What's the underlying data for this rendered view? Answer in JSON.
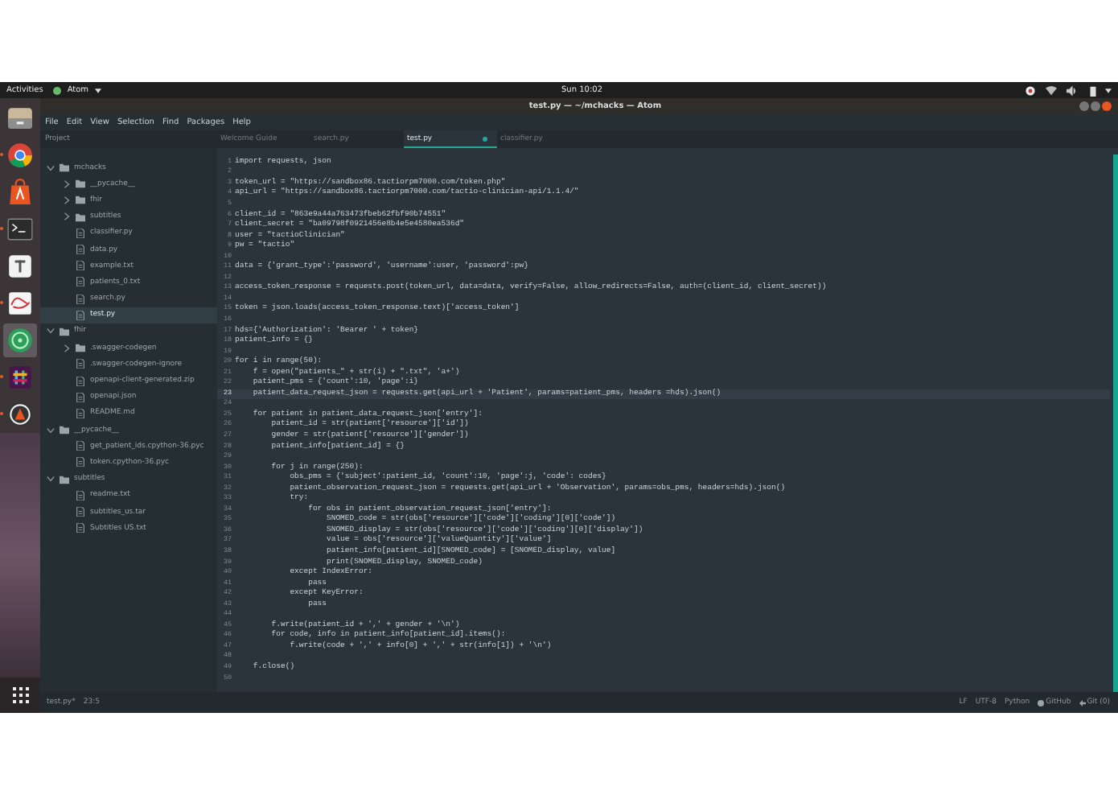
{
  "top_bar": {
    "activities": "Activities",
    "app_name": "Atom",
    "clock": "Sun 10:02"
  },
  "dock": {
    "items": [
      {
        "kind": "files",
        "running": false,
        "selected": false
      },
      {
        "kind": "browser",
        "running": true,
        "selected": false
      },
      {
        "kind": "store",
        "running": false,
        "selected": false
      },
      {
        "kind": "terminal",
        "running": true,
        "selected": false
      },
      {
        "kind": "notes",
        "running": false,
        "selected": false
      },
      {
        "kind": "scribble",
        "running": true,
        "selected": false
      },
      {
        "kind": "editor",
        "running": false,
        "selected": true
      },
      {
        "kind": "chat",
        "running": true,
        "selected": false
      },
      {
        "kind": "vpn",
        "running": true,
        "selected": false
      }
    ]
  },
  "window": {
    "title": "test.py — ~/mchacks — Atom"
  },
  "menu_bar": [
    "File",
    "Edit",
    "View",
    "Selection",
    "Find",
    "Packages",
    "Help"
  ],
  "sidebar": {
    "header": "Project",
    "tree": [
      {
        "name": "mchacks",
        "kind": "folder",
        "expanded": true,
        "selected": false,
        "children": [
          {
            "name": "__pycache__",
            "kind": "folder",
            "expanded": false,
            "selected": false
          },
          {
            "name": "fhir",
            "kind": "folder",
            "expanded": false,
            "selected": false
          },
          {
            "name": "subtitles",
            "kind": "folder",
            "expanded": false,
            "selected": false
          },
          {
            "name": "classifier.py",
            "kind": "file",
            "selected": false
          },
          {
            "name": "data.py",
            "kind": "file",
            "selected": false
          },
          {
            "name": "example.txt",
            "kind": "file",
            "selected": false
          },
          {
            "name": "patients_0.txt",
            "kind": "file",
            "selected": false
          },
          {
            "name": "search.py",
            "kind": "file",
            "selected": false
          },
          {
            "name": "test.py",
            "kind": "file",
            "selected": true
          }
        ]
      },
      {
        "name": "fhir",
        "kind": "folder",
        "expanded": true,
        "selected": false,
        "children": [
          {
            "name": ".swagger-codegen",
            "kind": "folder",
            "expanded": false,
            "selected": false
          },
          {
            "name": ".swagger-codegen-ignore",
            "kind": "file",
            "selected": false
          },
          {
            "name": "openapi-client-generated.zip",
            "kind": "file",
            "selected": false
          },
          {
            "name": "openapi.json",
            "kind": "file",
            "selected": false
          },
          {
            "name": "README.md",
            "kind": "file",
            "selected": false
          }
        ]
      },
      {
        "name": "__pycache__",
        "kind": "folder",
        "expanded": true,
        "selected": false,
        "children": [
          {
            "name": "get_patient_ids.cpython-36.pyc",
            "kind": "file",
            "selected": false
          },
          {
            "name": "token.cpython-36.pyc",
            "kind": "file",
            "selected": false
          }
        ]
      },
      {
        "name": "subtitles",
        "kind": "folder",
        "expanded": true,
        "selected": false,
        "children": [
          {
            "name": "readme.txt",
            "kind": "file",
            "selected": false
          },
          {
            "name": "subtitles_us.tar",
            "kind": "file",
            "selected": false
          },
          {
            "name": "Subtitles US.txt",
            "kind": "file",
            "selected": false
          }
        ]
      }
    ]
  },
  "tabs": [
    {
      "label": "Welcome Guide",
      "selected": false,
      "modified": false
    },
    {
      "label": "search.py",
      "selected": false,
      "modified": false
    },
    {
      "label": "test.py",
      "selected": true,
      "modified": true
    },
    {
      "label": "classifier.py",
      "selected": false,
      "modified": false
    }
  ],
  "editor": {
    "lines": [
      {
        "number": "1",
        "text": "import requests, json",
        "current": false
      },
      {
        "number": "2",
        "current": false
      },
      {
        "number": "3",
        "text": "token_url = \"https://sandbox86.tactiorpm7000.com/token.php\"",
        "current": false
      },
      {
        "number": "4",
        "text": "api_url = \"https://sandbox86.tactiorpm7000.com/tactio-clinician-api/1.1.4/\"",
        "current": false
      },
      {
        "number": "5",
        "current": false
      },
      {
        "number": "6",
        "text": "client_id = \"863e9a44a763473fbeb62fbf90b74551\"",
        "current": false
      },
      {
        "number": "7",
        "text": "client_secret = \"ba09798f0921456e8b4e5e4580ea536d\"",
        "current": false
      },
      {
        "number": "8",
        "text": "user = \"tactioClinician\"",
        "current": false
      },
      {
        "number": "9",
        "text": "pw = \"tactio\"",
        "current": false
      },
      {
        "number": "10",
        "current": false
      },
      {
        "number": "11",
        "text": "data = {'grant_type':'password', 'username':user, 'password':pw}",
        "current": false
      },
      {
        "number": "12",
        "current": false
      },
      {
        "number": "13",
        "text": "access_token_response = requests.post(token_url, data=data, verify=False, allow_redirects=False, auth=(client_id, client_secret))",
        "current": false
      },
      {
        "number": "14",
        "current": false
      },
      {
        "number": "15",
        "text": "token = json.loads(access_token_response.text)['access_token']",
        "current": false
      },
      {
        "number": "16",
        "current": false
      },
      {
        "number": "17",
        "text": "hds={'Authorization': 'Bearer ' + token}",
        "current": false
      },
      {
        "number": "18",
        "text": "patient_info = {}",
        "current": false
      },
      {
        "number": "19",
        "current": false
      },
      {
        "number": "20",
        "text": "for i in range(50):",
        "current": false
      },
      {
        "number": "21",
        "text": "    f = open(\"patients_\" + str(i) + \".txt\", 'a+')",
        "current": false
      },
      {
        "number": "22",
        "text": "    patient_pms = {'count':10, 'page':i}",
        "current": false
      },
      {
        "number": "23",
        "text": "    patient_data_request_json = requests.get(api_url + 'Patient', params=patient_pms, headers =hds).json()",
        "current": true
      },
      {
        "number": "24",
        "current": false
      },
      {
        "number": "25",
        "text": "    for patient in patient_data_request_json['entry']:",
        "current": false
      },
      {
        "number": "26",
        "text": "        patient_id = str(patient['resource']['id'])",
        "current": false
      },
      {
        "number": "27",
        "text": "        gender = str(patient['resource']['gender'])",
        "current": false
      },
      {
        "number": "28",
        "text": "        patient_info[patient_id] = {}",
        "current": false
      },
      {
        "number": "29",
        "current": false
      },
      {
        "number": "30",
        "text": "        for j in range(250):",
        "current": false
      },
      {
        "number": "31",
        "text": "            obs_pms = {'subject':patient_id, 'count':10, 'page':j, 'code': codes}",
        "current": false
      },
      {
        "number": "32",
        "text": "            patient_observation_request_json = requests.get(api_url + 'Observation', params=obs_pms, headers=hds).json()",
        "current": false
      },
      {
        "number": "33",
        "text": "            try:",
        "current": false
      },
      {
        "number": "34",
        "text": "                for obs in patient_observation_request_json['entry']:",
        "current": false
      },
      {
        "number": "35",
        "text": "                    SNOMED_code = str(obs['resource']['code']['coding'][0]['code'])",
        "current": false
      },
      {
        "number": "36",
        "text": "                    SNOMED_display = str(obs['resource']['code']['coding'][0]['display'])",
        "current": false
      },
      {
        "number": "37",
        "text": "                    value = obs['resource']['valueQuantity']['value']",
        "current": false
      },
      {
        "number": "38",
        "text": "                    patient_info[patient_id][SNOMED_code] = [SNOMED_display, value]",
        "current": false
      },
      {
        "number": "39",
        "text": "                    print(SNOMED_display, SNOMED_code)",
        "current": false
      },
      {
        "number": "40",
        "text": "            except IndexError:",
        "current": false
      },
      {
        "number": "41",
        "text": "                pass",
        "current": false
      },
      {
        "number": "42",
        "text": "            except KeyError:",
        "current": false
      },
      {
        "number": "43",
        "text": "                pass",
        "current": false
      },
      {
        "number": "44",
        "current": false
      },
      {
        "number": "45",
        "text": "        f.write(patient_id + ',' + gender + '\\n')",
        "current": false
      },
      {
        "number": "46",
        "text": "        for code, info in patient_info[patient_id].items():",
        "current": false
      },
      {
        "number": "47",
        "text": "            f.write(code + ',' + info[0] + ',' + str(info[1]) + '\\n')",
        "current": false
      },
      {
        "number": "48",
        "current": false
      },
      {
        "number": "49",
        "text": "    f.close()",
        "current": false
      },
      {
        "number": "50",
        "current": false
      }
    ]
  },
  "status_bar": {
    "file": "test.py*",
    "cursor": "23:5",
    "line_ending": "LF",
    "encoding": "UTF-8",
    "grammar": "Python",
    "github": "GitHub",
    "git": "Git (0)"
  }
}
